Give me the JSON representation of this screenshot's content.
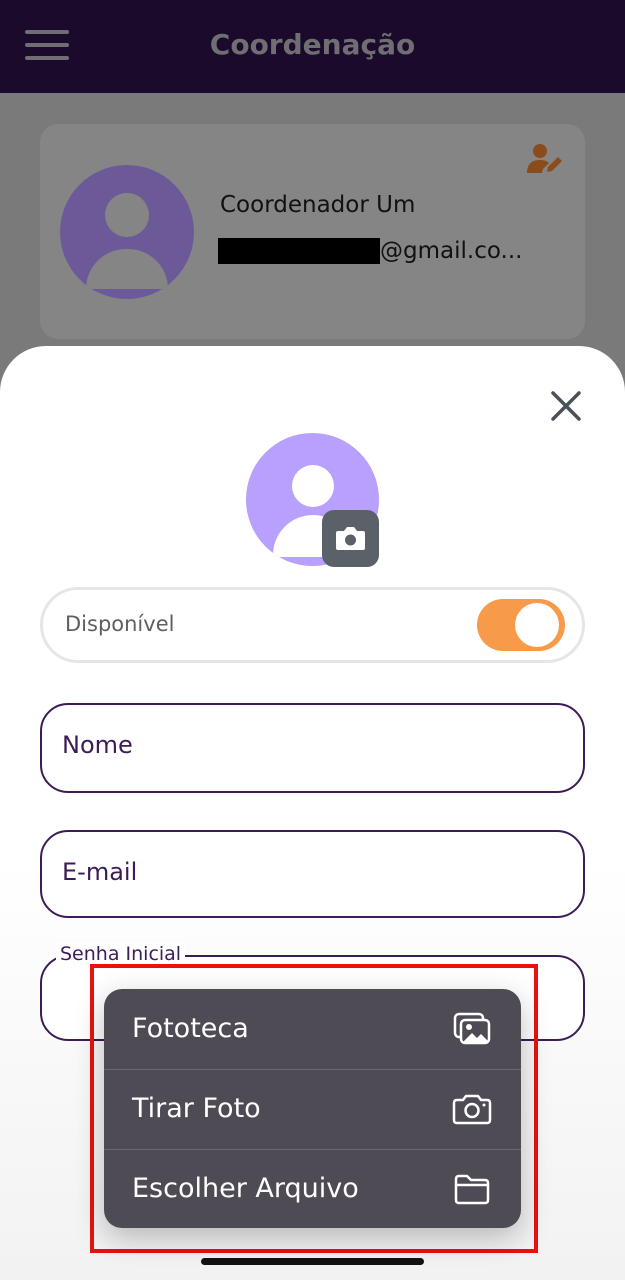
{
  "header": {
    "title": "Coordenação"
  },
  "profile_card": {
    "name": "Coordenador Um",
    "email_suffix": "@gmail.co..."
  },
  "form": {
    "availability_label": "Disponível",
    "availability_on": true,
    "name_placeholder": "Nome",
    "email_placeholder": "E-mail",
    "password_label": "Senha Inicial"
  },
  "photo_menu": {
    "items": [
      {
        "label": "Fototeca",
        "icon": "photo-library-icon"
      },
      {
        "label": "Tirar Foto",
        "icon": "camera-icon"
      },
      {
        "label": "Escolher Arquivo",
        "icon": "folder-icon"
      }
    ]
  },
  "colors": {
    "header_bg": "#1b0a2b",
    "accent_orange": "#f79b4a",
    "avatar_purple": "#b8a0ff",
    "field_border": "#3c1c57",
    "highlight_red": "#e8120e"
  }
}
